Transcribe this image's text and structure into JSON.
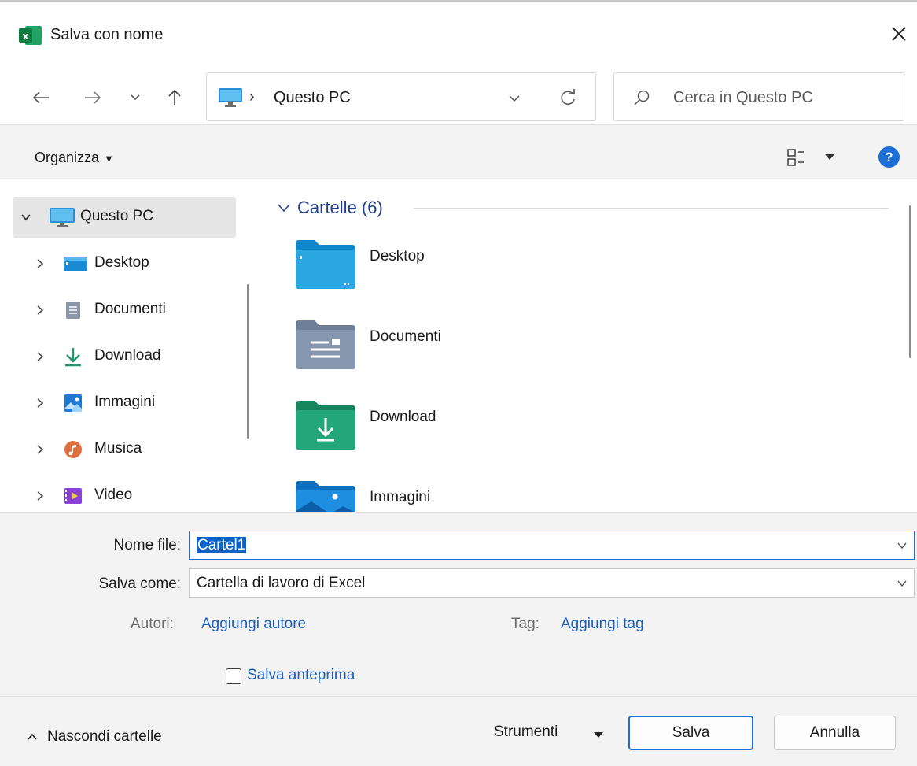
{
  "window": {
    "title": "Salva con nome",
    "app_icon": "excel-icon",
    "close_icon": "close-icon"
  },
  "nav": {
    "back_icon": "back-arrow-icon",
    "forward_icon": "forward-arrow-icon",
    "recent_icon": "chevron-down-icon",
    "up_icon": "up-arrow-icon",
    "address_crumb": "Questo PC",
    "search_placeholder": "Cerca in Questo PC"
  },
  "command_bar": {
    "organize_label": "Organizza",
    "help_label": "?"
  },
  "sidebar": {
    "items": [
      {
        "label": "Questo PC",
        "icon": "computer-icon",
        "expanded": true,
        "selected": true
      },
      {
        "label": "Desktop",
        "icon": "desktop-icon",
        "expanded": false
      },
      {
        "label": "Documenti",
        "icon": "documents-icon",
        "expanded": false
      },
      {
        "label": "Download",
        "icon": "download-icon",
        "expanded": false
      },
      {
        "label": "Immagini",
        "icon": "pictures-icon",
        "expanded": false
      },
      {
        "label": "Musica",
        "icon": "music-icon",
        "expanded": false
      },
      {
        "label": "Video",
        "icon": "video-icon",
        "expanded": false
      }
    ]
  },
  "content": {
    "group_label": "Cartelle (6)",
    "folders": [
      {
        "label": "Desktop",
        "icon": "desktop-folder-icon"
      },
      {
        "label": "Documenti",
        "icon": "documents-folder-icon"
      },
      {
        "label": "Download",
        "icon": "download-folder-icon"
      },
      {
        "label": "Immagini",
        "icon": "pictures-folder-icon"
      }
    ]
  },
  "form": {
    "filename_label": "Nome file:",
    "filename_value": "Cartel1",
    "savetype_label": "Salva come:",
    "savetype_value": "Cartella di lavoro di Excel",
    "authors_label": "Autori:",
    "authors_link": "Aggiungi autore",
    "tags_label": "Tag:",
    "tags_link": "Aggiungi tag",
    "preview_label": "Salva anteprima",
    "preview_checked": false
  },
  "footer": {
    "hide_folders_label": "Nascondi cartelle",
    "tools_label": "Strumenti",
    "save_label": "Salva",
    "cancel_label": "Annulla"
  },
  "colors": {
    "accent": "#1b6fd6",
    "link": "#1a5fc0",
    "excel_green": "#107c41",
    "selection": "#0b63c7"
  }
}
